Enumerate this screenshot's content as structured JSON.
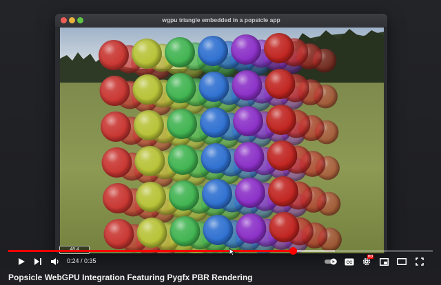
{
  "window": {
    "title": "wgpu triangle embedded in a popsicle app"
  },
  "player": {
    "time_display": "0:24 / 0:35",
    "hover_time": "48.4",
    "progress_fraction": 0.67,
    "loaded_fraction": 0.77,
    "accent_color": "#ff0000",
    "hd_badge": "HD",
    "icons": [
      "play-icon",
      "next-icon",
      "volume-icon",
      "autoplay-toggle-icon",
      "subtitles-icon",
      "settings-icon",
      "miniplayer-icon",
      "theater-icon",
      "fullscreen-icon"
    ]
  },
  "video": {
    "title": "Popsicle WebGPU Integration Featuring Pygfx PBR Rendering"
  }
}
